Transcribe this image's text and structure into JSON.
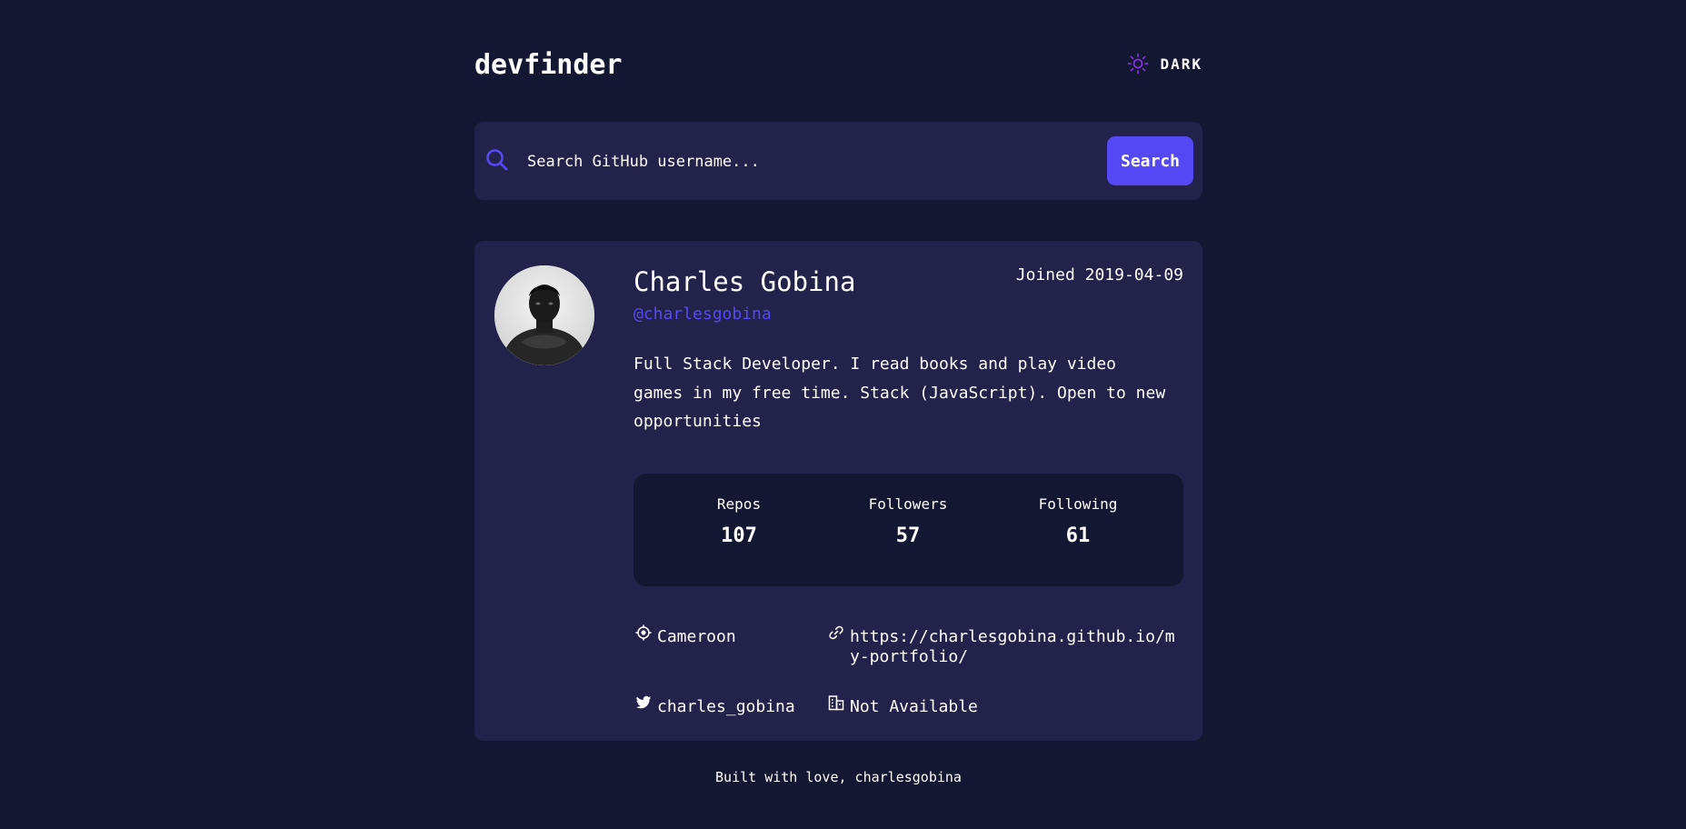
{
  "app": {
    "title": "devfinder",
    "theme_toggle_label": "DARK",
    "colors": {
      "background": "#141731",
      "card": "#22224a",
      "accent": "#5649f5",
      "link": "#5549f1",
      "theme_icon": "#7e34d8"
    }
  },
  "search": {
    "placeholder": "Search GitHub username...",
    "value": "",
    "button_label": "Search",
    "icon": "search-icon"
  },
  "profile": {
    "name": "Charles Gobina",
    "handle": "@charlesgobina",
    "joined": "Joined 2019-04-09",
    "bio": "Full Stack Developer. I read books and play video games in my free time. Stack (JavaScript). Open to new opportunities",
    "stats": [
      {
        "label": "Repos",
        "value": "107"
      },
      {
        "label": "Followers",
        "value": "57"
      },
      {
        "label": "Following",
        "value": "61"
      }
    ],
    "info": {
      "location": {
        "icon": "location-icon",
        "text": "Cameroon"
      },
      "website": {
        "icon": "link-icon",
        "text": "https://charlesgobina.github.io/my-portfolio/"
      },
      "twitter": {
        "icon": "twitter-icon",
        "text": "charles_gobina"
      },
      "company": {
        "icon": "building-icon",
        "text": "Not Available"
      }
    }
  },
  "footer": {
    "text": "Built with love, charlesgobina"
  }
}
